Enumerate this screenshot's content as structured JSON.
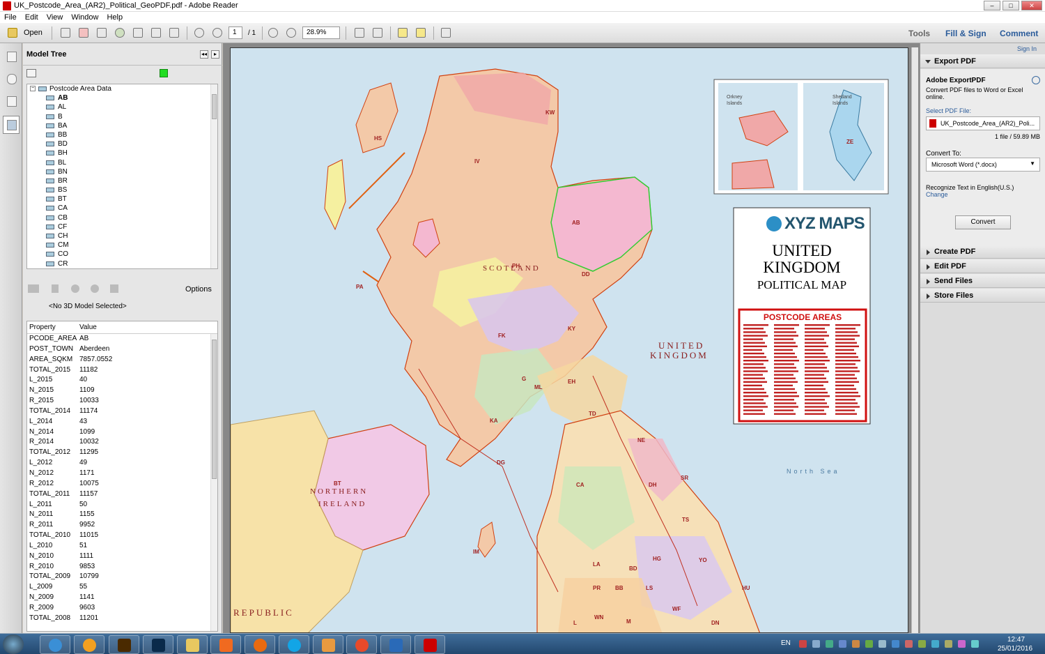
{
  "window": {
    "title": "UK_Postcode_Area_(AR2)_Political_GeoPDF.pdf - Adobe Reader"
  },
  "menu": [
    "File",
    "Edit",
    "View",
    "Window",
    "Help"
  ],
  "toolbar": {
    "open_label": "Open",
    "page_current": "1",
    "page_total": "/ 1",
    "zoom": "28.9%",
    "tools": "Tools",
    "fill_sign": "Fill & Sign",
    "comment": "Comment"
  },
  "model_tree": {
    "title": "Model Tree",
    "root": "Postcode Area Data",
    "items": [
      "AB",
      "AL",
      "B",
      "BA",
      "BB",
      "BD",
      "BH",
      "BL",
      "BN",
      "BR",
      "BS",
      "BT",
      "CA",
      "CB",
      "CF",
      "CH",
      "CM",
      "CO",
      "CR"
    ],
    "selected": "AB",
    "options_label": "Options",
    "no_model": "<No 3D Model Selected>",
    "prop_header": "Property",
    "value_header": "Value",
    "properties": [
      [
        "PCODE_AREA",
        "AB"
      ],
      [
        "POST_TOWN",
        "Aberdeen"
      ],
      [
        "AREA_SQKM",
        "7857.0552"
      ],
      [
        "TOTAL_2015",
        "11182"
      ],
      [
        "L_2015",
        "40"
      ],
      [
        "N_2015",
        "1109"
      ],
      [
        "R_2015",
        "10033"
      ],
      [
        "TOTAL_2014",
        "11174"
      ],
      [
        "L_2014",
        "43"
      ],
      [
        "N_2014",
        "1099"
      ],
      [
        "R_2014",
        "10032"
      ],
      [
        "TOTAL_2012",
        "11295"
      ],
      [
        "L_2012",
        "49"
      ],
      [
        "N_2012",
        "1171"
      ],
      [
        "R_2012",
        "10075"
      ],
      [
        "TOTAL_2011",
        "11157"
      ],
      [
        "L_2011",
        "50"
      ],
      [
        "N_2011",
        "1155"
      ],
      [
        "R_2011",
        "9952"
      ],
      [
        "TOTAL_2010",
        "11015"
      ],
      [
        "L_2010",
        "51"
      ],
      [
        "N_2010",
        "1111"
      ],
      [
        "R_2010",
        "9853"
      ],
      [
        "TOTAL_2009",
        "10799"
      ],
      [
        "L_2009",
        "55"
      ],
      [
        "N_2009",
        "1141"
      ],
      [
        "R_2009",
        "9603"
      ],
      [
        "TOTAL_2008",
        "11201"
      ]
    ]
  },
  "right_panel": {
    "sign_in": "Sign In",
    "export_pdf": "Export PDF",
    "adobe_export": "Adobe ExportPDF",
    "export_desc": "Convert PDF files to Word or Excel online.",
    "select_pdf_label": "Select PDF File:",
    "file_name": "UK_Postcode_Area_(AR2)_Poli...",
    "file_info": "1 file / 59.89 MB",
    "convert_to_label": "Convert To:",
    "convert_to_value": "Microsoft Word (*.docx)",
    "recognize": "Recognize Text in English(U.S.)",
    "change": "Change",
    "convert_button": "Convert",
    "sections": [
      "Create PDF",
      "Edit PDF",
      "Send Files",
      "Store Files"
    ]
  },
  "map": {
    "brand": "XYZ MAPS",
    "title_line1": "UNITED",
    "title_line2": "KINGDOM",
    "title_line3": "POLITICAL MAP",
    "legend_title": "POSTCODE AREAS",
    "inset_left": "Orkney Islands",
    "inset_right": "Shetland Islands",
    "label_scotland": "SCOTLAND",
    "label_uk_1": "UNITED",
    "label_uk_2": "KINGDOM",
    "label_ni_1": "NORTHERN",
    "label_ni_2": "IRELAND",
    "label_republic": "REPUBLIC",
    "label_north_sea": "North Sea",
    "postcodes": [
      "KW",
      "IV",
      "HS",
      "AB",
      "DD",
      "PH",
      "PA",
      "FK",
      "KY",
      "EH",
      "G",
      "ML",
      "KA",
      "TD",
      "DG",
      "NE",
      "CA",
      "DH",
      "SR",
      "TS",
      "BT",
      "LA",
      "HG",
      "YO",
      "BD",
      "LS",
      "HU",
      "DN",
      "PR",
      "BB",
      "WN",
      "L",
      "M",
      "WF",
      "IM",
      "ZE"
    ]
  },
  "taskbar": {
    "lang": "EN",
    "time": "12:47",
    "date": "25/01/2016"
  }
}
